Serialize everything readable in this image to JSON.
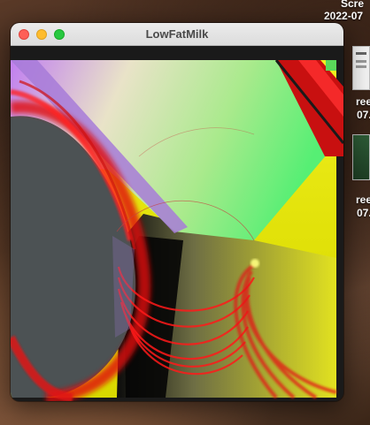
{
  "window": {
    "title": "LowFatMilk"
  },
  "desktop": {
    "items": [
      {
        "label_line1": "Scre",
        "label_line2": "2022-07"
      },
      {
        "label_line1": "ree",
        "label_line2": "07."
      },
      {
        "label_line1": "ree",
        "label_line2": "07."
      }
    ]
  }
}
